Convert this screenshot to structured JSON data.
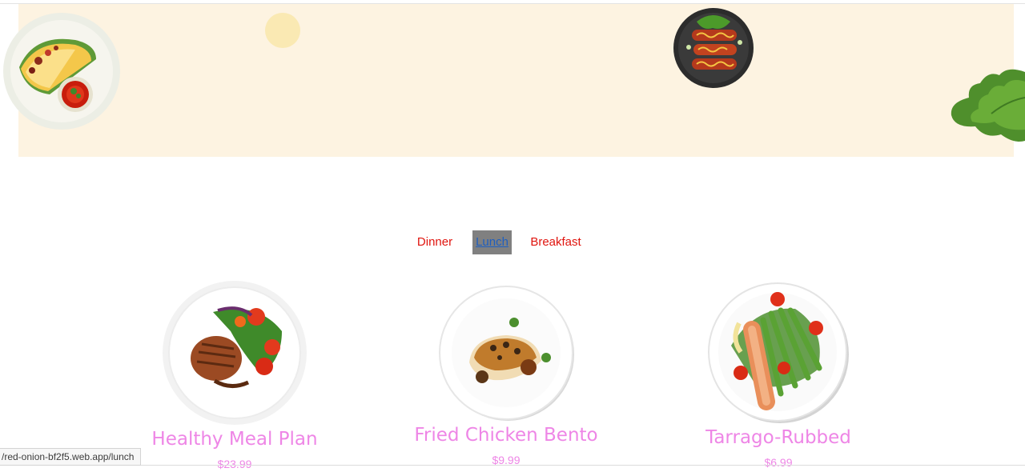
{
  "menu": {
    "tabs": [
      {
        "label": "Dinner",
        "active": false
      },
      {
        "label": "Lunch",
        "active": true
      },
      {
        "label": "Breakfast",
        "active": false
      }
    ]
  },
  "items": [
    {
      "title": "Healthy Meal Plan",
      "price": "$23.99"
    },
    {
      "title": "Fried Chicken Bento",
      "price": "$9.99"
    },
    {
      "title": "Tarrago-Rubbed",
      "price": "$6.99"
    }
  ],
  "status_bar": {
    "url": "/red-onion-bf2f5.web.app/lunch"
  },
  "colors": {
    "banner_bg": "#fdf3e1",
    "tab_text": "#e0140e",
    "active_tab_bg": "#808080",
    "title_pink": "#ee86e6"
  },
  "icons": [
    "taco-plate-icon",
    "lemon-slice-icon",
    "sausage-plate-icon",
    "lettuce-leaf-icon"
  ]
}
